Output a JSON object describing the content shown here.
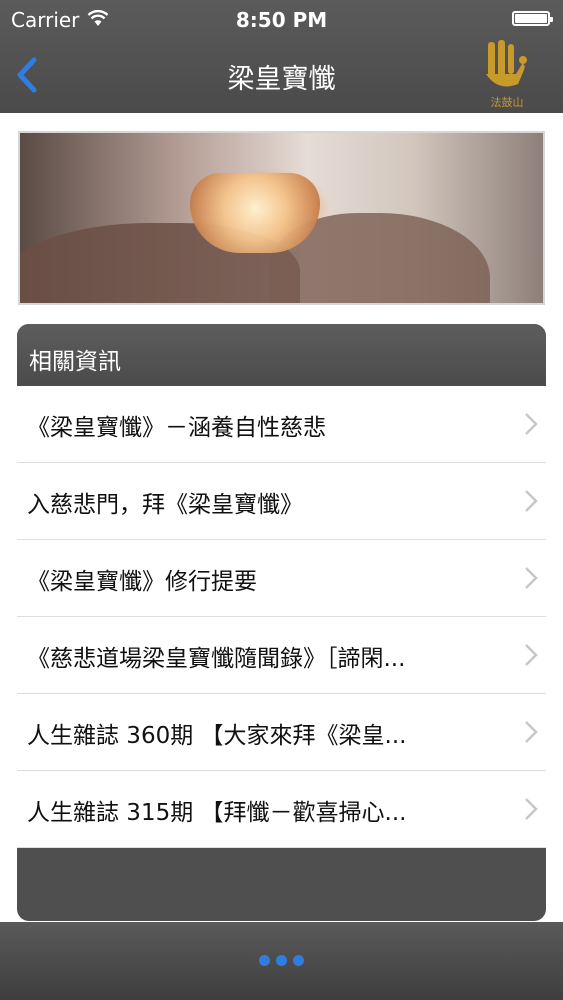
{
  "status_bar": {
    "carrier": "Carrier",
    "time": "8:50 PM"
  },
  "nav": {
    "title": "梁皇寶懺",
    "logo_text": "法鼓山"
  },
  "section": {
    "title": "相關資訊"
  },
  "items": [
    {
      "label": "《梁皇寶懺》－涵養自性慈悲"
    },
    {
      "label": "入慈悲門，拜《梁皇寶懺》"
    },
    {
      "label": "《梁皇寶懺》修行提要"
    },
    {
      "label": "《慈悲道場梁皇寶懺隨聞錄》［諦閑..."
    },
    {
      "label": "人生雜誌 360期 【大家來拜《梁皇..."
    },
    {
      "label": "人生雜誌 315期 【拜懺－歡喜掃心..."
    }
  ],
  "colors": {
    "accent": "#2f7de1",
    "bar": "#4f4f4f",
    "logo": "#c79a2a"
  }
}
